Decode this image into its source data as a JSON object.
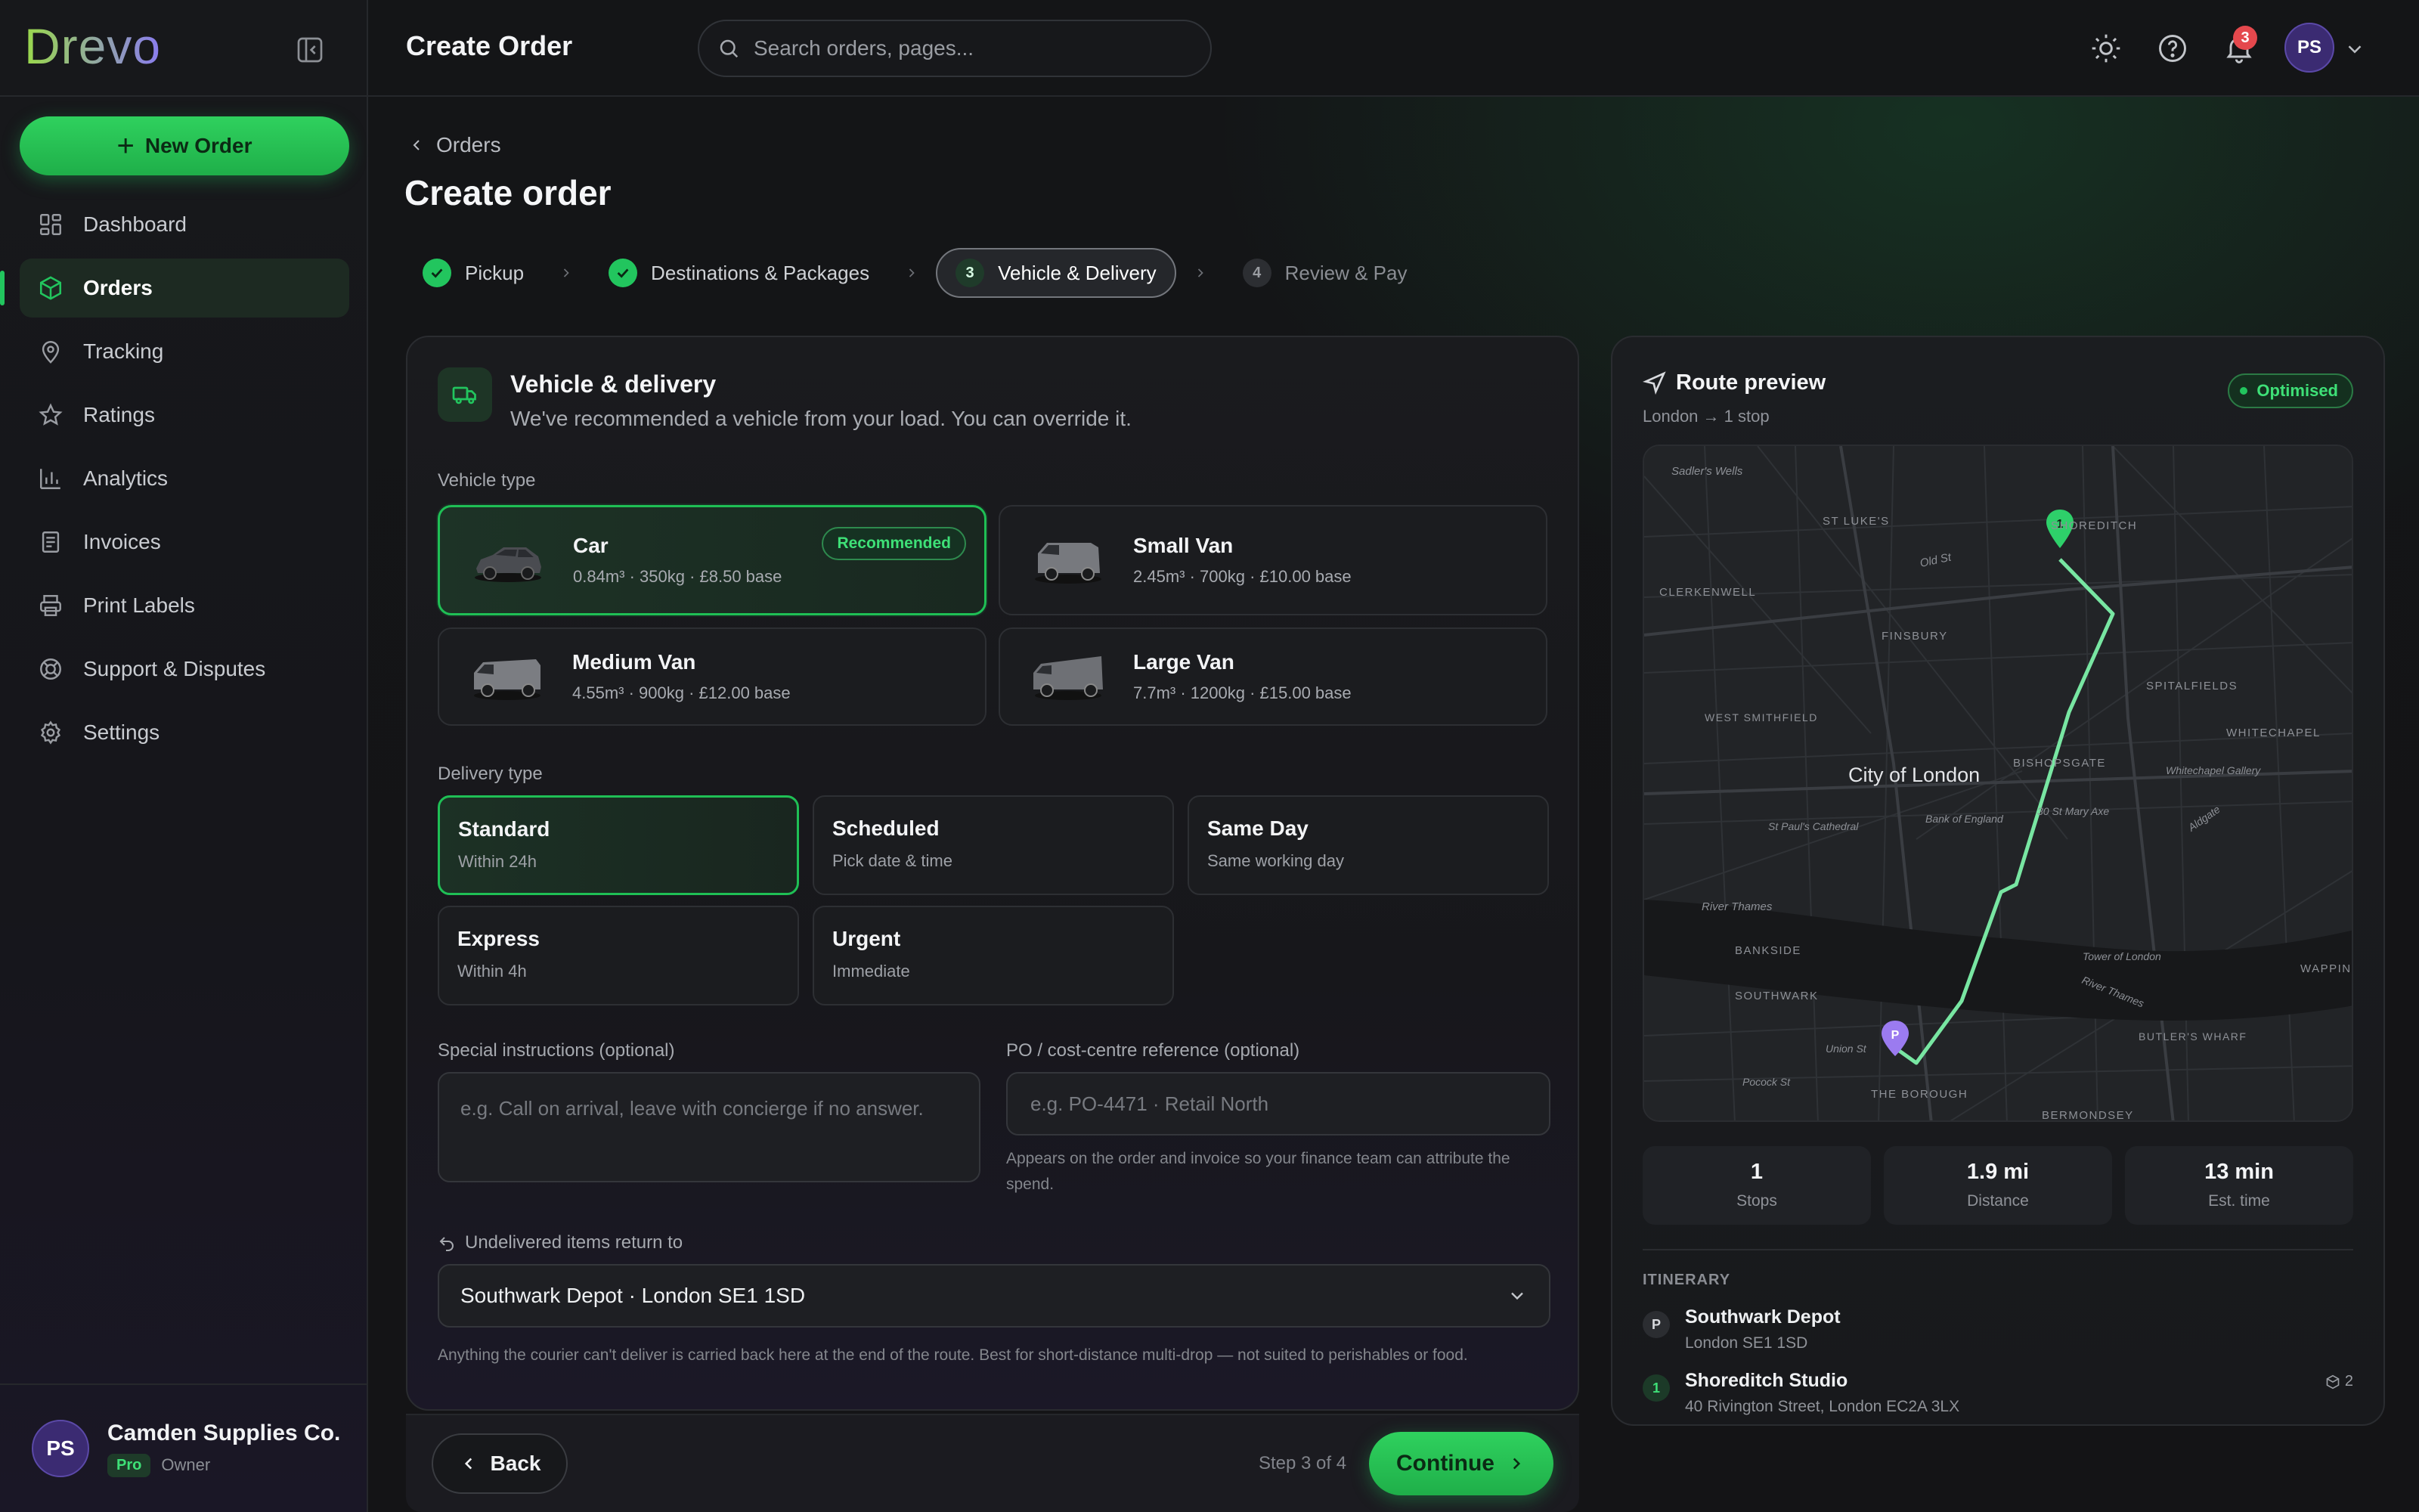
{
  "brand": {
    "logo_text": "Drevo",
    "accent": "#22c55e"
  },
  "sidebar": {
    "new_order_label": "New Order",
    "items": [
      {
        "label": "Dashboard",
        "icon": "dashboard-icon"
      },
      {
        "label": "Orders",
        "icon": "box-icon",
        "active": true
      },
      {
        "label": "Tracking",
        "icon": "map-pin-icon"
      },
      {
        "label": "Ratings",
        "icon": "star-icon"
      },
      {
        "label": "Analytics",
        "icon": "bar-chart-icon"
      },
      {
        "label": "Invoices",
        "icon": "invoice-icon"
      },
      {
        "label": "Print Labels",
        "icon": "printer-icon"
      },
      {
        "label": "Support & Disputes",
        "icon": "lifebuoy-icon"
      },
      {
        "label": "Settings",
        "icon": "gear-icon"
      }
    ],
    "account": {
      "initials": "PS",
      "name": "Camden Supplies Co.",
      "plan": "Pro",
      "role": "Owner"
    }
  },
  "topbar": {
    "title": "Create Order",
    "search_placeholder": "Search orders, pages...",
    "notification_count": "3",
    "avatar_initials": "PS"
  },
  "page": {
    "breadcrumb": "Orders",
    "title": "Create order",
    "steps": [
      {
        "label": "Pickup",
        "state": "done"
      },
      {
        "label": "Destinations & Packages",
        "state": "done"
      },
      {
        "number": "3",
        "label": "Vehicle & Delivery",
        "state": "current"
      },
      {
        "number": "4",
        "label": "Review & Pay",
        "state": "todo"
      }
    ]
  },
  "vehicle_card": {
    "title": "Vehicle & delivery",
    "subtitle": "We've recommended a vehicle from your load. You can override it.",
    "vehicle_type_label": "Vehicle type",
    "recommended_label": "Recommended",
    "vehicles": [
      {
        "name": "Car",
        "meta": "0.84m³ · 350kg · £8.50 base",
        "selected": true
      },
      {
        "name": "Small Van",
        "meta": "2.45m³ · 700kg · £10.00 base"
      },
      {
        "name": "Medium Van",
        "meta": "4.55m³ · 900kg · £12.00 base"
      },
      {
        "name": "Large Van",
        "meta": "7.7m³ · 1200kg · £15.00 base"
      }
    ],
    "delivery_type_label": "Delivery type",
    "delivery_types": [
      {
        "name": "Standard",
        "sub": "Within 24h",
        "selected": true
      },
      {
        "name": "Scheduled",
        "sub": "Pick date & time"
      },
      {
        "name": "Same Day",
        "sub": "Same working day"
      },
      {
        "name": "Express",
        "sub": "Within 4h"
      },
      {
        "name": "Urgent",
        "sub": "Immediate"
      }
    ],
    "instructions_label": "Special instructions (optional)",
    "instructions_placeholder": "e.g. Call on arrival, leave with concierge if no answer.",
    "po_label": "PO / cost-centre reference (optional)",
    "po_placeholder": "e.g. PO-4471 · Retail North",
    "po_help": "Appears on the order and invoice so your finance team can attribute the spend.",
    "return_label": "Undelivered items return to",
    "return_value": "Southwark Depot · London SE1 1SD",
    "return_help": "Anything the courier can't deliver is carried back here at the end of the route. Best for short-distance multi-drop — not suited to perishables or food."
  },
  "actions": {
    "back_label": "Back",
    "step_count": "Step 3 of 4",
    "continue_label": "Continue"
  },
  "route": {
    "title": "Route preview",
    "subtitle": "London → 1 stop",
    "badge": "Optimised",
    "map_labels": [
      "Sadler's Wells",
      "ST LUKE'S",
      "SHOREDITCH",
      "Old St",
      "CLERKENWELL",
      "FINSBURY",
      "SPITALFIELDS",
      "WEST SMITHFIELD",
      "City of London",
      "BISHOPSGATE",
      "WHITECHAPEL",
      "Whitechapel Gallery",
      "St Paul's Cathedral",
      "Bank of England",
      "30 St Mary Axe",
      "Aldgate",
      "River Thames",
      "BANKSIDE",
      "Tower of London",
      "River Thames",
      "SOUTHWARK",
      "WAPPING",
      "BUTLER'S WHARF",
      "Union St",
      "Pocock St",
      "THE BOROUGH",
      "BERMONDSEY"
    ],
    "pickup_marker": "P",
    "stop_marker": "1",
    "stats": [
      {
        "value": "1",
        "label": "Stops"
      },
      {
        "value": "1.9 mi",
        "label": "Distance"
      },
      {
        "value": "13 min",
        "label": "Est. time"
      }
    ],
    "itinerary_label": "ITINERARY",
    "itinerary": [
      {
        "badge": "P",
        "name": "Southwark Depot",
        "address": "London SE1 1SD"
      },
      {
        "badge": "1",
        "name": "Shoreditch Studio",
        "address": "40 Rivington Street, London EC2A 3LX",
        "packages": "2"
      }
    ]
  }
}
